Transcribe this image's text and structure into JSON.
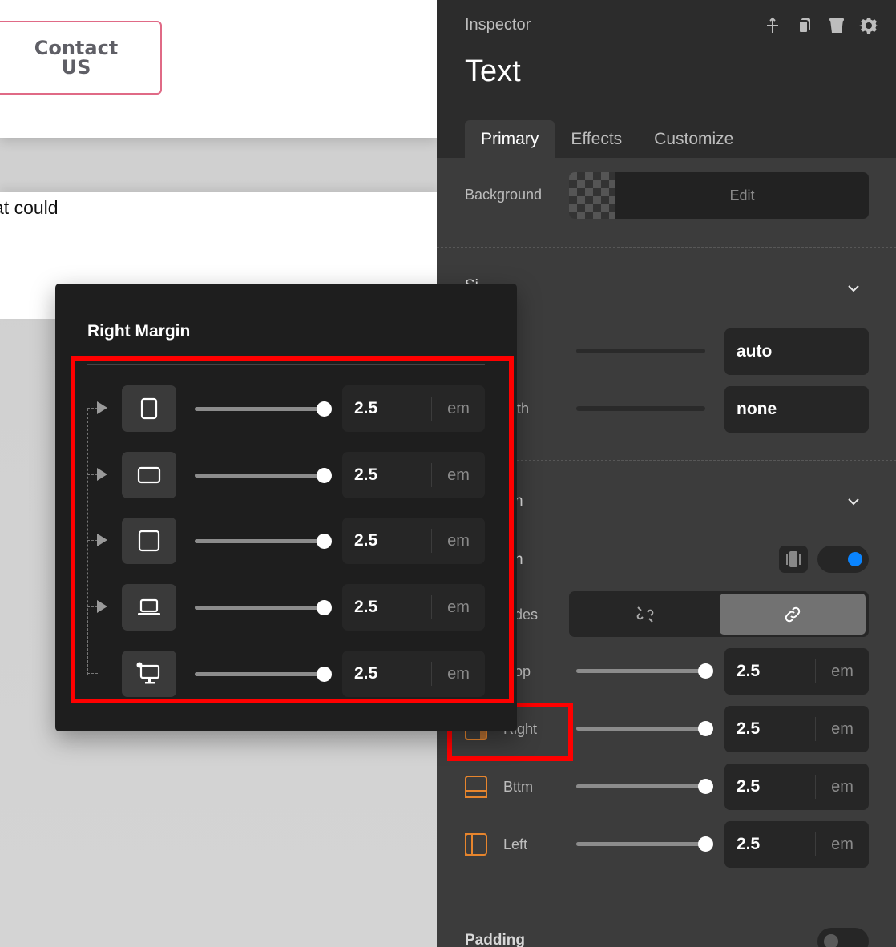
{
  "canvas": {
    "contact_button": "Contact US",
    "body_text": "at could"
  },
  "inspector": {
    "label": "Inspector",
    "title": "Text",
    "top_icons": [
      "add-icon",
      "copy-icon",
      "trash-icon",
      "gear-icon"
    ],
    "tabs": [
      {
        "label": "Primary",
        "active": true
      },
      {
        "label": "Effects",
        "active": false
      },
      {
        "label": "Customize",
        "active": false
      }
    ],
    "background": {
      "label": "Background",
      "button": "Edit"
    },
    "size_section_partial": "Si",
    "fields": [
      {
        "label_partial": "",
        "value": "auto"
      },
      {
        "label_partial": "dth",
        "value": "none"
      }
    ],
    "margin_section_partial": "n",
    "margin_toggle_partial": "n",
    "sides_label_partial": "des",
    "margin_sides": [
      {
        "label": "op",
        "value": "2.5",
        "unit": "em",
        "level": 1
      },
      {
        "label": "Right",
        "value": "2.5",
        "unit": "em",
        "level": 1
      },
      {
        "label": "Bttm",
        "value": "2.5",
        "unit": "em",
        "level": 1
      },
      {
        "label": "Left",
        "value": "2.5",
        "unit": "em",
        "level": 1
      }
    ],
    "padding_label": "Padding",
    "colors": {
      "accent": "#0a84ff",
      "orange": "#e7852d",
      "highlight": "#ff0000"
    }
  },
  "popover": {
    "title": "Right Margin",
    "breakpoints": [
      {
        "icon": "phone-portrait-icon",
        "value": "2.5",
        "unit": "em",
        "level": 1
      },
      {
        "icon": "phone-landscape-icon",
        "value": "2.5",
        "unit": "em",
        "level": 1
      },
      {
        "icon": "tablet-icon",
        "value": "2.5",
        "unit": "em",
        "level": 1
      },
      {
        "icon": "laptop-icon",
        "value": "2.5",
        "unit": "em",
        "level": 1
      },
      {
        "icon": "desktop-icon",
        "value": "2.5",
        "unit": "em",
        "level": 1
      }
    ]
  }
}
